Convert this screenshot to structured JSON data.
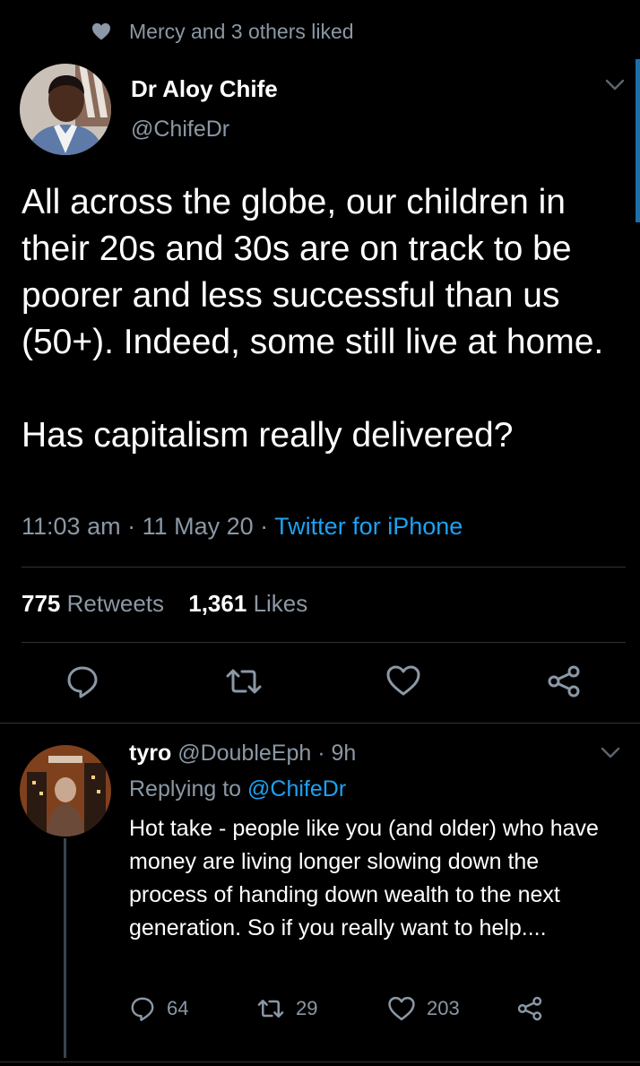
{
  "social_context": {
    "text": "Mercy and 3 others liked",
    "icon": "heart-icon"
  },
  "tweet": {
    "author_name": "Dr Aloy Chife",
    "author_handle": "@ChifeDr",
    "paragraph1": "All across the globe, our children in their 20s and 30s are on track to be poorer and less successful than us (50+). Indeed, some still live at home.",
    "paragraph2": "Has capitalism really delivered?",
    "time": "11:03 am",
    "date": "11 May 20",
    "source": "Twitter for iPhone",
    "retweets": "775",
    "retweets_label": "Retweets",
    "likes": "1,361",
    "likes_label": "Likes",
    "actions": [
      "reply-icon",
      "retweet-icon",
      "like-icon",
      "share-icon"
    ]
  },
  "reply": {
    "author_name": "tyro",
    "author_handle": "@DoubleEph",
    "age": "9h",
    "replying_prefix": "Replying to",
    "replying_to": "@ChifeDr",
    "text": "Hot take - people like you (and older) who have money are living longer slowing down the process of handing down wealth to the next generation. So if you really want to help....",
    "reply_count": "64",
    "retweet_count": "29",
    "like_count": "203"
  },
  "colors": {
    "background": "#000000",
    "text": "#ffffff",
    "secondary": "#8b98a5",
    "link": "#1da1f2",
    "divider": "#2f3336"
  }
}
